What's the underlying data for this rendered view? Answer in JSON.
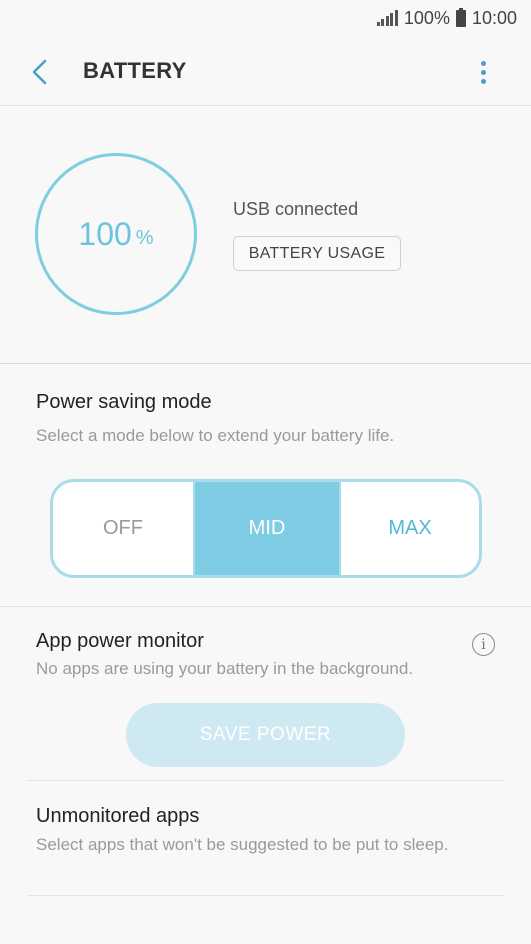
{
  "status_bar": {
    "battery_percent": "100%",
    "time": "10:00"
  },
  "header": {
    "title": "BATTERY"
  },
  "battery": {
    "value": "100",
    "unit": "%",
    "status": "USB connected",
    "usage_button": "BATTERY USAGE"
  },
  "power_saving": {
    "title": "Power saving mode",
    "description": "Select a mode below to extend your battery life.",
    "modes": [
      "OFF",
      "MID",
      "MAX"
    ],
    "selected": "MID"
  },
  "app_power_monitor": {
    "title": "App power monitor",
    "description": "No apps are using your battery in the background.",
    "button": "SAVE POWER"
  },
  "unmonitored": {
    "title": "Unmonitored apps",
    "description": "Select apps that won't be suggested to be put to sleep."
  },
  "colors": {
    "accent": "#7fcde4",
    "link": "#4a9fc4"
  }
}
